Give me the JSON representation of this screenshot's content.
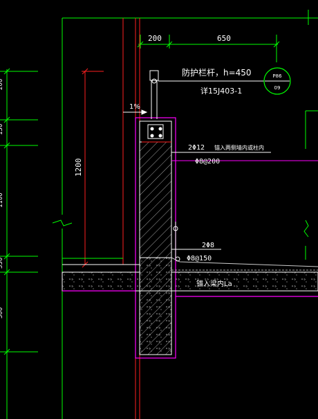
{
  "drawing": {
    "dimensions": {
      "left_width": "200",
      "right_width": "650",
      "wall_height": "1200"
    },
    "labels": {
      "guardrail": "防护栏杆，h=450",
      "detail_ref": "详15J403-1",
      "slope": "1%",
      "top_rebar": "2Φ12",
      "top_rebar_note": "锚入两侧墙内或柱内",
      "top_stirrup": "Φ8@200",
      "mid_rebar": "2Φ8",
      "mid_stirrup": "Φ8@150",
      "anchor_note": "锚入梁内La"
    },
    "callout": {
      "top": "P86",
      "bottom": "09"
    },
    "left_ticks": [
      "200",
      "150",
      "1100",
      "350",
      "300"
    ],
    "colors": {
      "background": "#000000",
      "outline": "#ff00ff",
      "dimension": "#00ff00",
      "section_line": "#ff0000",
      "text": "#ffffff",
      "hatch": "#ffffff"
    }
  }
}
